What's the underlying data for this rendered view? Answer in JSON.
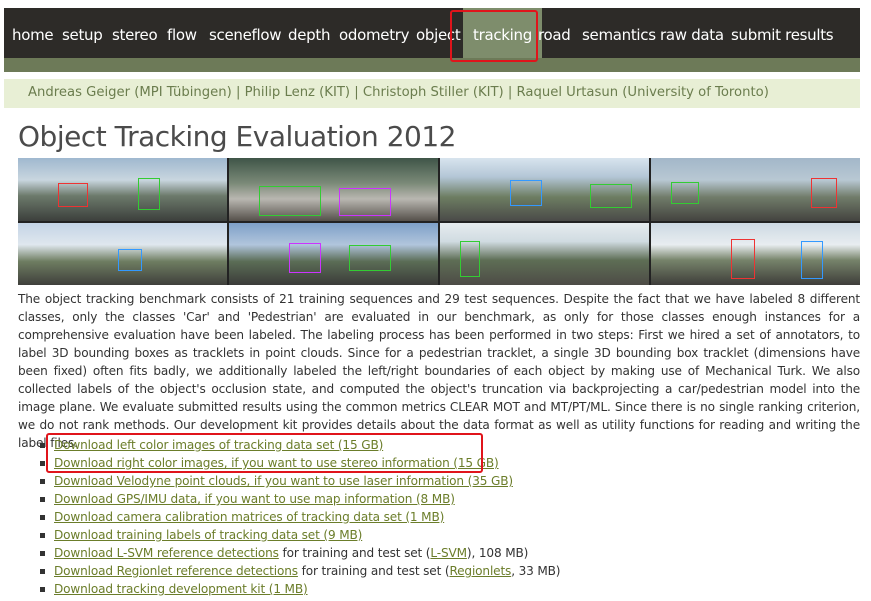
{
  "nav": {
    "items": [
      {
        "label": "home",
        "active": false
      },
      {
        "label": "setup",
        "active": false
      },
      {
        "label": "stereo",
        "active": false
      },
      {
        "label": "flow",
        "active": false
      },
      {
        "label": "sceneflow",
        "active": false
      },
      {
        "label": "depth",
        "active": false
      },
      {
        "label": "odometry",
        "active": false
      },
      {
        "label": "object",
        "active": false
      },
      {
        "label": "tracking",
        "active": true
      },
      {
        "label": "road",
        "active": false
      },
      {
        "label": "semantics",
        "active": false
      },
      {
        "label": "raw data",
        "active": false
      },
      {
        "label": "submit results",
        "active": false
      }
    ]
  },
  "authors": "Andreas Geiger (MPI Tübingen) | Philip Lenz (KIT) | Christoph Stiller (KIT) | Raquel Urtasun (University of Toronto)",
  "page_title": "Object Tracking Evaluation 2012",
  "description": "The object tracking benchmark consists of 21 training sequences and 29 test sequences. Despite the fact that we have labeled 8 different classes, only the classes 'Car' and 'Pedestrian' are evaluated in our benchmark, as only for those classes enough instances for a comprehensive evaluation have been labeled. The labeling process has been performed in two steps: First we hired a set of annotators, to label 3D bounding boxes as tracklets in point clouds. Since for a pedestrian tracklet, a single 3D bounding box tracklet (dimensions have been fixed) often fits badly, we additionally labeled the left/right boundaries of each object by making use of Mechanical Turk. We also collected labels of the object's occlusion state, and computed the object's truncation via backprojecting a car/pedestrian model into the image plane. We evaluate submitted results using the common metrics CLEAR MOT and MT/PT/ML. Since there is no single ranking criterion, we do not rank methods. Our development kit provides details about the data format as well as utility functions for reading and writing the label files.",
  "downloads": {
    "left_color": "Download left color images of tracking data set (15 GB)",
    "right_color": "Download right color images, if you want to use stereo information (15 GB)",
    "velodyne": "Download Velodyne point clouds, if you want to use laser information (35 GB)",
    "gps_imu": "Download GPS/IMU data, if you want to use map information (8 MB)",
    "calib": "Download camera calibration matrices of tracking data set (1 MB)",
    "labels": "Download training labels of tracking data set (9 MB)",
    "lsvm_link": "Download L-SVM reference detections",
    "lsvm_text1": " for training and test set (",
    "lsvm_ref": "L-SVM",
    "lsvm_text2": "), 108 MB)",
    "regionlet_link": "Download Regionlet reference detections",
    "regionlet_text1": " for training and test set (",
    "regionlet_ref": "Regionlets",
    "regionlet_text2": ", 33 MB)",
    "devkit": "Download tracking development kit (1 MB)"
  },
  "colors": {
    "nav_bg": "#2d2b28",
    "nav_active": "#7e8d6c",
    "authors_bg": "#e8efd5",
    "link": "#6b7d2a",
    "highlight": "#e0141b"
  }
}
